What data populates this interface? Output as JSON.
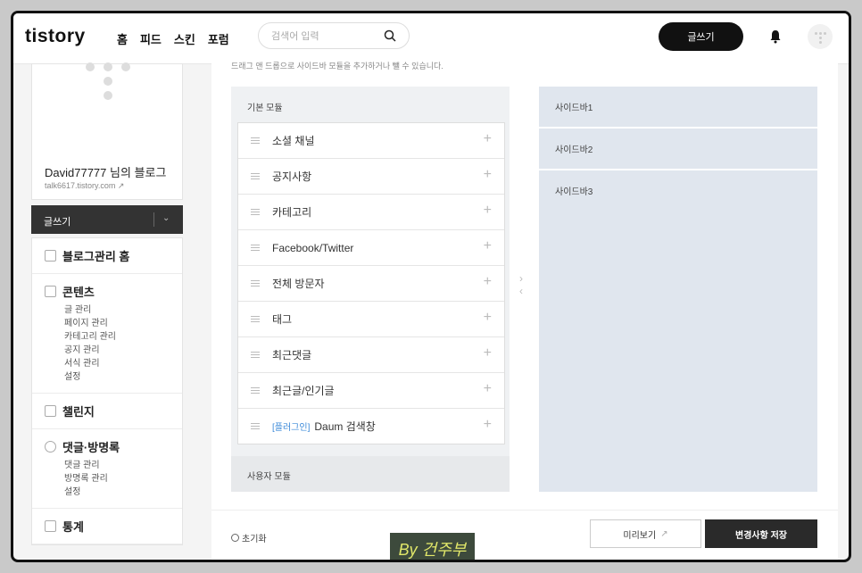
{
  "header": {
    "logo": "tistory",
    "nav": [
      "홈",
      "피드",
      "스킨",
      "포럼"
    ],
    "search_placeholder": "검색어 입력",
    "write_label": "글쓰기"
  },
  "sidebar": {
    "blog_name": "David77777 님의 블로그",
    "blog_url": "talk6617.tistory.com",
    "write_label": "글쓰기",
    "sections": [
      {
        "title": "블로그관리 홈",
        "items": []
      },
      {
        "title": "콘텐츠",
        "items": [
          "글 관리",
          "페이지 관리",
          "카테고리 관리",
          "공지 관리",
          "서식 관리",
          "설정"
        ]
      },
      {
        "title": "챌린지",
        "items": []
      },
      {
        "title": "댓글·방명록",
        "items": [
          "댓글 관리",
          "방명록 관리",
          "설정"
        ]
      },
      {
        "title": "통계",
        "items": []
      }
    ]
  },
  "main": {
    "hint": "드래그 앤 드롭으로 사이드바 모듈을 추가하거나 뺄 수 있습니다.",
    "basic_modules_title": "기본 모듈",
    "modules": [
      {
        "tag": "",
        "label": "소셜 채널"
      },
      {
        "tag": "",
        "label": "공지사항"
      },
      {
        "tag": "",
        "label": "카테고리"
      },
      {
        "tag": "",
        "label": "Facebook/Twitter"
      },
      {
        "tag": "",
        "label": "전체 방문자"
      },
      {
        "tag": "",
        "label": "태그"
      },
      {
        "tag": "",
        "label": "최근댓글"
      },
      {
        "tag": "",
        "label": "최근글/인기글"
      },
      {
        "tag": "[플러그인]",
        "label": "Daum 검색창"
      }
    ],
    "user_modules_title": "사용자 모듈",
    "sidebars": [
      "사이드바1",
      "사이드바2",
      "사이드바3"
    ]
  },
  "footer": {
    "reset_label": "초기화",
    "preview_label": "미리보기",
    "save_label": "변경사항 저장"
  },
  "watermark": "By 건주부"
}
